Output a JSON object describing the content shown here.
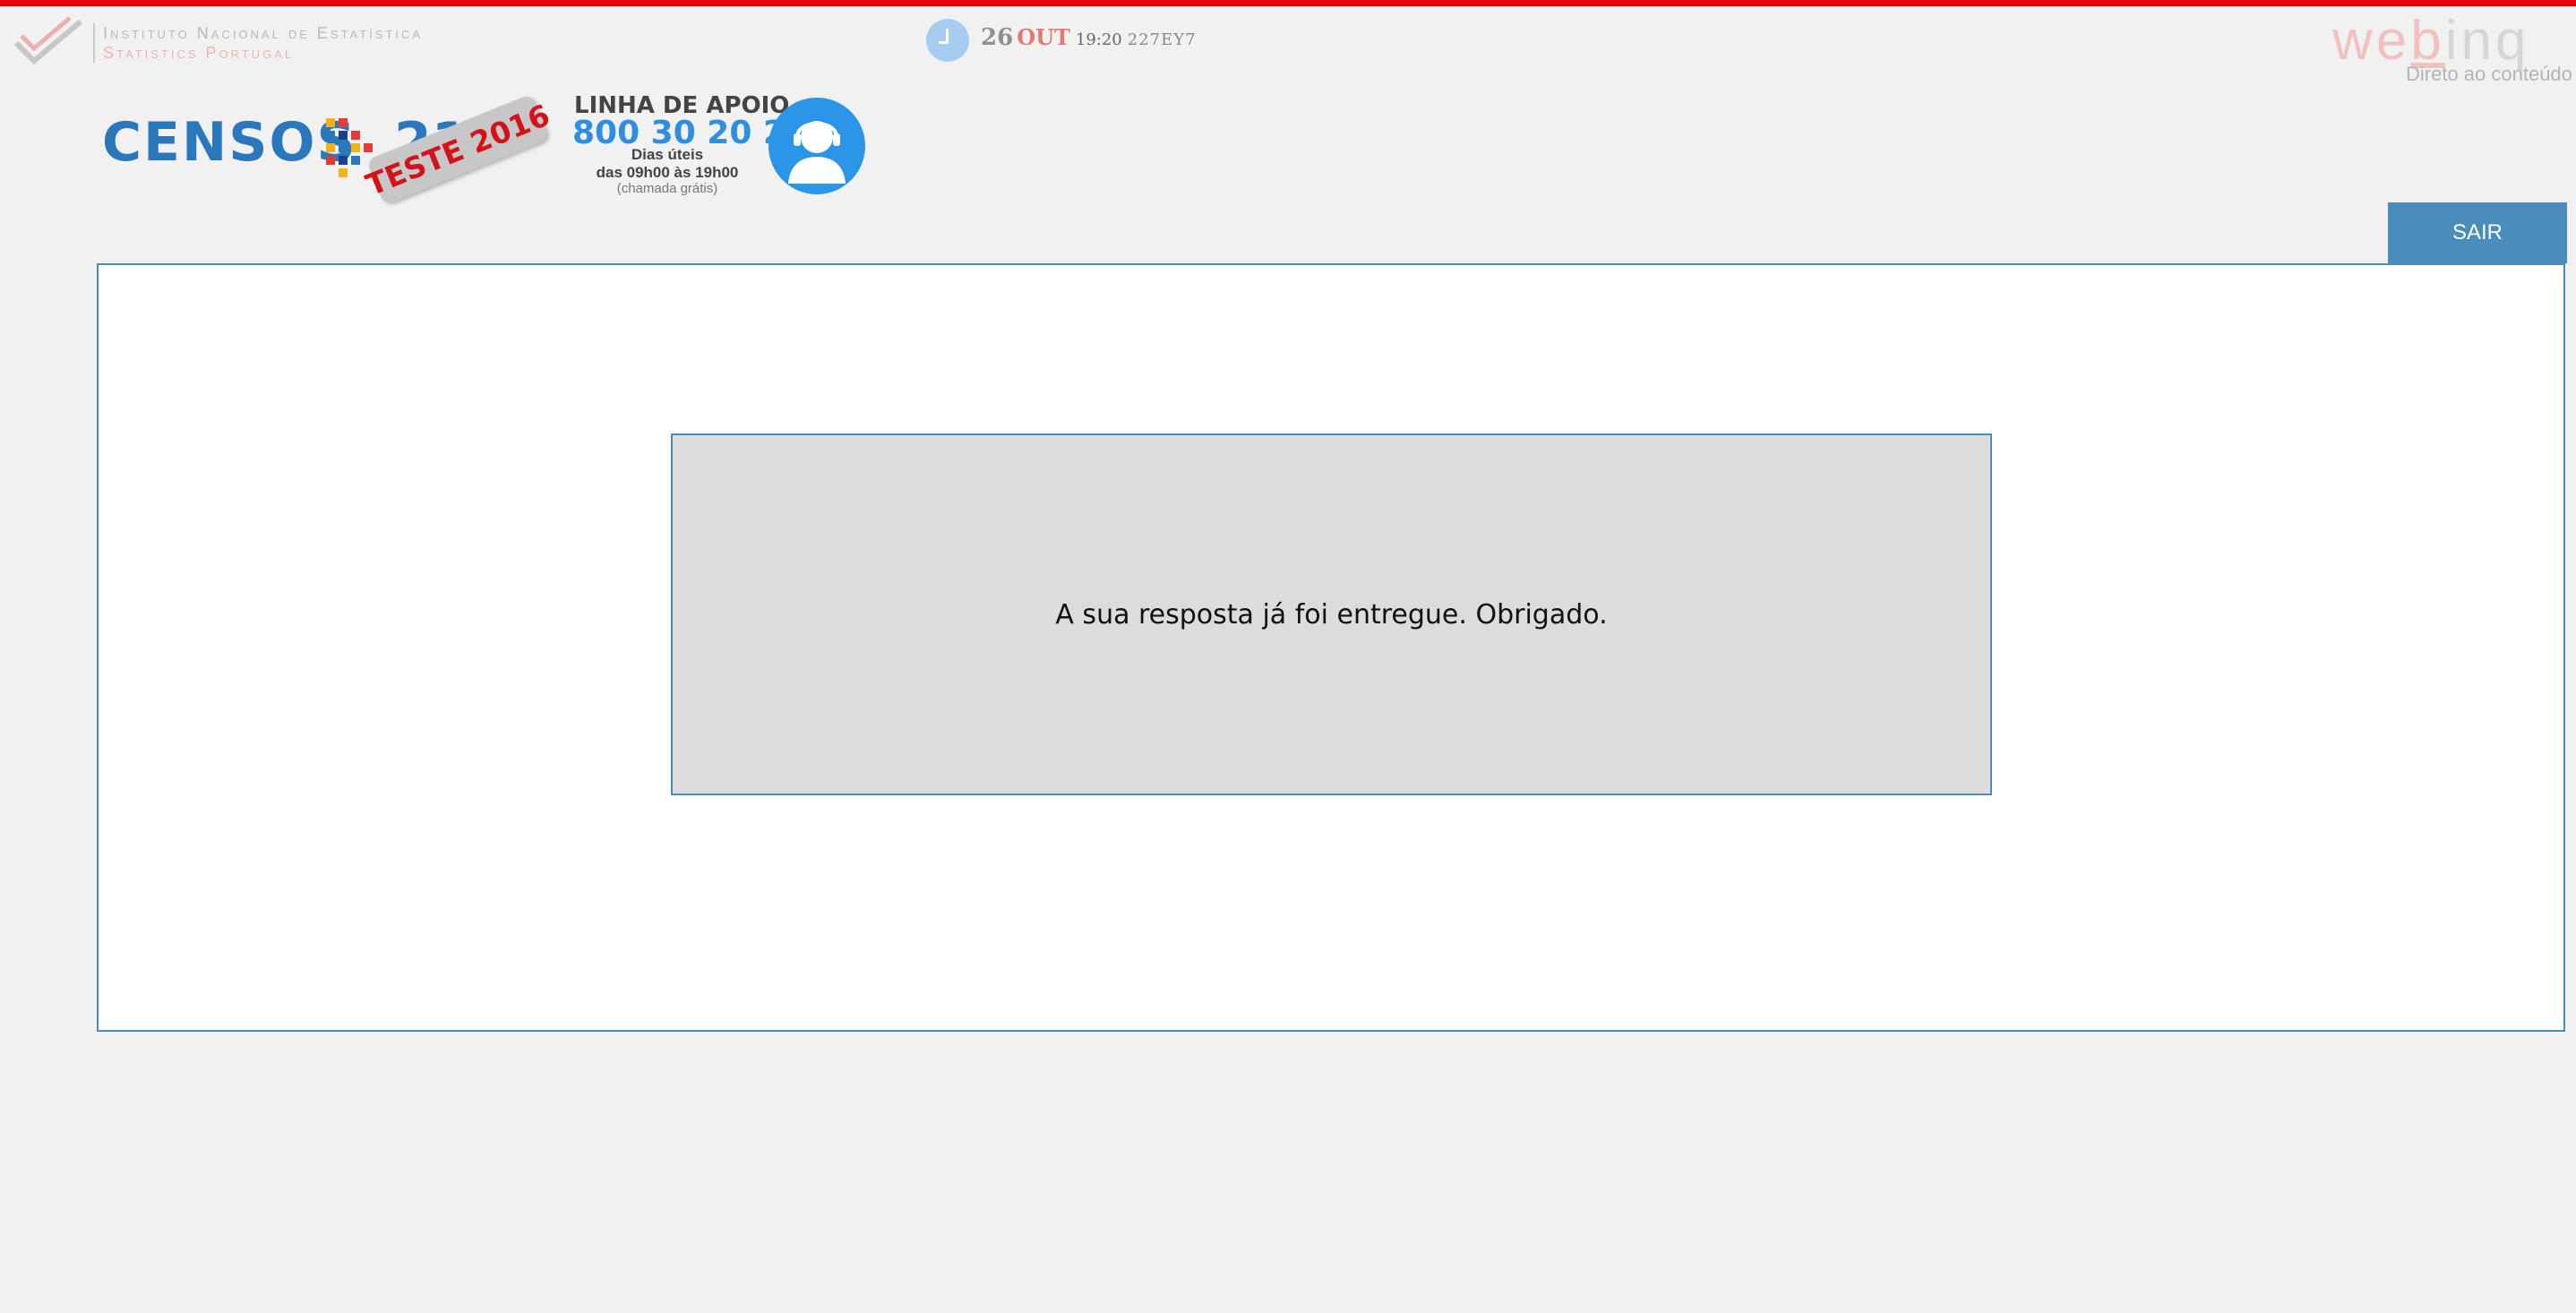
{
  "header": {
    "institute": {
      "name": "Instituto Nacional de Estatística",
      "name_en": "Statistics Portugal",
      "logo_icon": "ine-check-logo-icon"
    },
    "date": {
      "day": "26",
      "month": "OUT",
      "time": "19:20",
      "code": "227EY7",
      "icon": "clock-icon"
    },
    "app": {
      "logo_web": "we",
      "logo_b": "b",
      "logo_inq": "inq",
      "skip_link": "Direto ao conteúdo"
    }
  },
  "branding": {
    "censos": "CENSOS",
    "year": "21",
    "stamp": "TESTE 2016"
  },
  "support": {
    "title": "LINHA DE APOIO",
    "phone": "800 30 20 21",
    "days": "Dias úteis",
    "hours": "das 09h00 às 19h00",
    "cost": "(chamada grátis)",
    "icon": "support-agent-icon"
  },
  "actions": {
    "exit_label": "SAIR"
  },
  "main": {
    "message": "A sua resposta já foi entregue. Obrigado."
  },
  "colors": {
    "accent_red": "#e8000b",
    "panel_blue": "#4a8dbb",
    "brand_blue": "#2b77bb",
    "support_blue": "#2b95e8"
  }
}
